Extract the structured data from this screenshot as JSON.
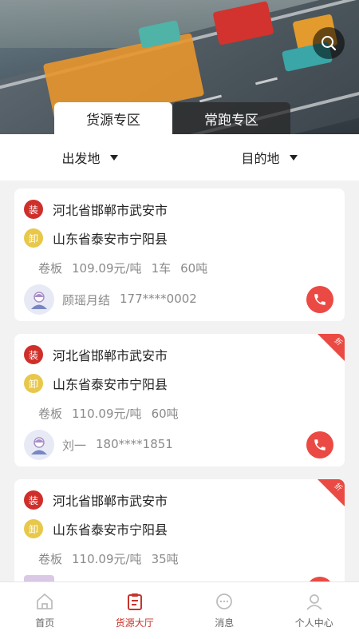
{
  "tabs": [
    {
      "label": "货源专区",
      "active": true
    },
    {
      "label": "常跑专区",
      "active": false
    }
  ],
  "filters": {
    "origin": "出发地",
    "destination": "目的地"
  },
  "cards": [
    {
      "load_badge": "装",
      "unload_badge": "卸",
      "load_place": "河北省邯郸市武安市",
      "unload_place": "山东省泰安市宁阳县",
      "cargo": [
        "卷板",
        "109.09元/吨",
        "1车",
        "60吨"
      ],
      "contact_name": "顾瑶月结",
      "contact_phone": "177****0002",
      "corner_tag": ""
    },
    {
      "load_badge": "装",
      "unload_badge": "卸",
      "load_place": "河北省邯郸市武安市",
      "unload_place": "山东省泰安市宁阳县",
      "cargo": [
        "卷板",
        "110.09元/吨",
        "60吨"
      ],
      "contact_name": "刘一",
      "contact_phone": "180****1851",
      "corner_tag": "折"
    },
    {
      "load_badge": "装",
      "unload_badge": "卸",
      "load_place": "河北省邯郸市武安市",
      "unload_place": "山东省泰安市宁阳县",
      "cargo": [
        "卷板",
        "110.09元/吨",
        "35吨"
      ],
      "contact_name": "",
      "contact_phone": "",
      "corner_tag": "折"
    }
  ],
  "nav": [
    {
      "label": "首页",
      "icon": "home-icon",
      "active": false
    },
    {
      "label": "货源大厅",
      "icon": "clipboard-icon",
      "active": true
    },
    {
      "label": "消息",
      "icon": "chat-icon",
      "active": false
    },
    {
      "label": "个人中心",
      "icon": "user-icon",
      "active": false
    }
  ],
  "colors": {
    "accent": "#c6342b",
    "phone": "#ea4a43",
    "load_badge": "#cf2f2a",
    "unload_badge": "#e8c84a"
  }
}
